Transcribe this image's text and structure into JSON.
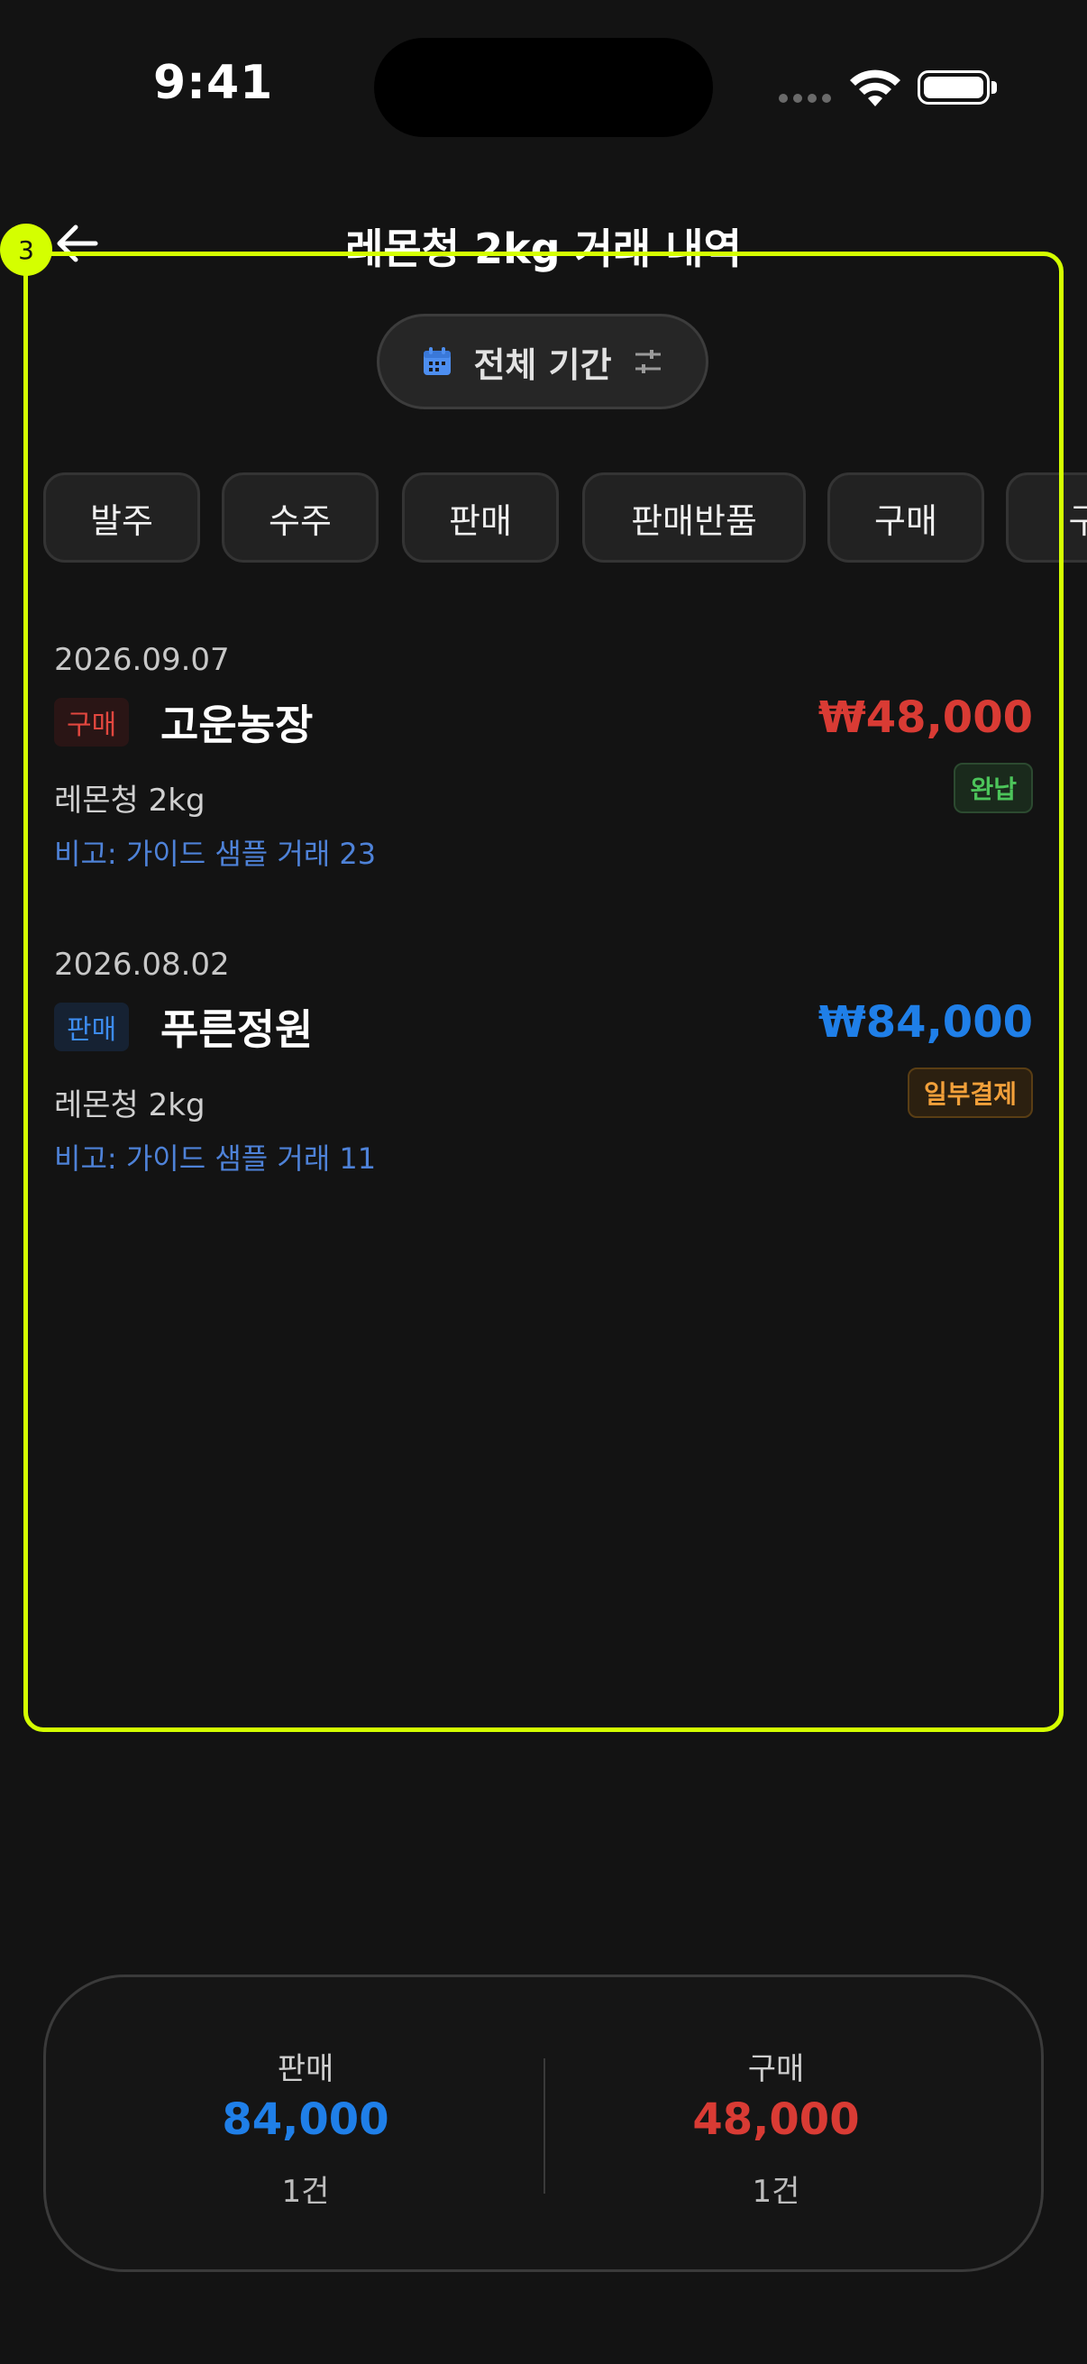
{
  "status_bar": {
    "time": "9:41"
  },
  "header": {
    "title": "레몬청 2kg 거래 내역"
  },
  "annotation": {
    "marker": "3",
    "color": "#d4ff00"
  },
  "period": {
    "label": "전체 기간"
  },
  "filters": [
    "발주",
    "수주",
    "판매",
    "판매반품",
    "구매",
    "구"
  ],
  "transactions": [
    {
      "date": "2026.09.07",
      "type": "구매",
      "party": "고운농장",
      "amount": "₩48,000",
      "item": "레몬청 2kg",
      "note": "비고: 가이드 샘플 거래 23",
      "status": "완납"
    },
    {
      "date": "2026.08.02",
      "type": "판매",
      "party": "푸른정원",
      "amount": "₩84,000",
      "item": "레몬청 2kg",
      "note": "비고: 가이드 샘플 거래 11",
      "status": "일부결제"
    }
  ],
  "summary": {
    "sales": {
      "label": "판매",
      "value": "84,000",
      "count": "1건"
    },
    "purchase": {
      "label": "구매",
      "value": "48,000",
      "count": "1건"
    }
  },
  "colors": {
    "sell": "#1f7fe8",
    "buy": "#d93b34",
    "paid": "#4cc45a",
    "partial": "#f2a03a"
  }
}
